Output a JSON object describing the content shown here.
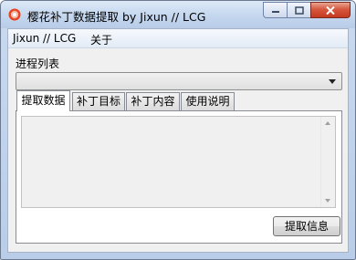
{
  "window": {
    "title": "樱花补丁数据提取 by Jixun // LCG",
    "icon": "sakura-app-icon"
  },
  "menu": {
    "items": [
      "Jixun // LCG",
      "关于"
    ]
  },
  "process": {
    "label": "进程列表",
    "selected": ""
  },
  "tabs": [
    {
      "label": "提取数据",
      "active": true
    },
    {
      "label": "补丁目标",
      "active": false
    },
    {
      "label": "补丁内容",
      "active": false
    },
    {
      "label": "使用说明",
      "active": false
    }
  ],
  "output": {
    "text": ""
  },
  "actions": {
    "extract_label": "提取信息"
  }
}
